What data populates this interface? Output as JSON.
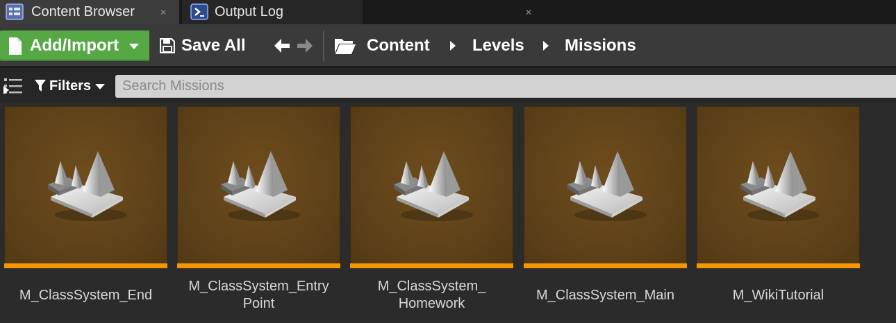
{
  "tabs": [
    {
      "label": "Content Browser",
      "icon": "content-browser-icon"
    },
    {
      "label": "Output Log",
      "icon": "output-log-icon"
    }
  ],
  "toolbar": {
    "add_import_label": "Add/Import",
    "save_all_label": "Save All"
  },
  "breadcrumb": [
    "Content",
    "Levels",
    "Missions"
  ],
  "filters": {
    "label": "Filters"
  },
  "search": {
    "placeholder": "Search Missions",
    "value": ""
  },
  "assets": [
    {
      "name_lines": [
        "M_ClassSystem_End"
      ],
      "icon": "level-asset-icon"
    },
    {
      "name_lines": [
        "M_ClassSystem_Entry",
        "Point"
      ],
      "icon": "level-asset-icon"
    },
    {
      "name_lines": [
        "M_ClassSystem_",
        "Homework"
      ],
      "icon": "level-asset-icon"
    },
    {
      "name_lines": [
        "M_ClassSystem_Main"
      ],
      "icon": "level-asset-icon"
    },
    {
      "name_lines": [
        "M_WikiTutorial"
      ],
      "icon": "level-asset-icon"
    }
  ],
  "colors": {
    "add_import_green": "#56a845",
    "asset_type_bar": "#f59800",
    "thumbnail_brown": "#60431a"
  }
}
